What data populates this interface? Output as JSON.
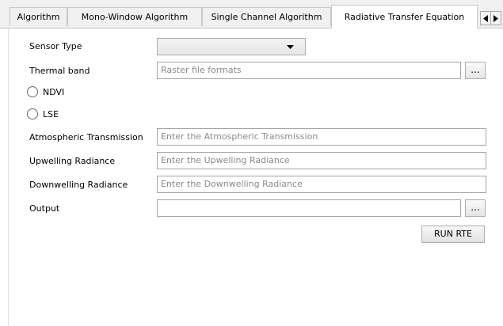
{
  "tabs": [
    {
      "label": "Algorithm"
    },
    {
      "label": "Mono-Window Algorithm"
    },
    {
      "label": "Single Channel Algorithm"
    },
    {
      "label": "Radiative Transfer Equation"
    }
  ],
  "form": {
    "sensor_type": {
      "label": "Sensor Type",
      "value": ""
    },
    "thermal_band": {
      "label": "Thermal band",
      "placeholder": "Raster file formats",
      "browse_label": "..."
    },
    "ndvi": {
      "label": "NDVI",
      "checked": false
    },
    "lse": {
      "label": "LSE",
      "checked": false
    },
    "atmospheric_transmission": {
      "label": "Atmospheric Transmission",
      "placeholder": "Enter the Atmospheric Transmission"
    },
    "upwelling_radiance": {
      "label": "Upwelling Radiance",
      "placeholder": "Enter the Upwelling Radiance"
    },
    "downwelling_radiance": {
      "label": "Downwelling Radiance",
      "placeholder": "Enter the Downwelling Radiance"
    },
    "output": {
      "label": "Output",
      "value": "",
      "browse_label": "..."
    },
    "run_button": "RUN RTE"
  },
  "icons": {
    "dropdown": "chevron-down-icon",
    "scroll_left": "arrow-left-icon",
    "scroll_right": "arrow-right-icon"
  }
}
